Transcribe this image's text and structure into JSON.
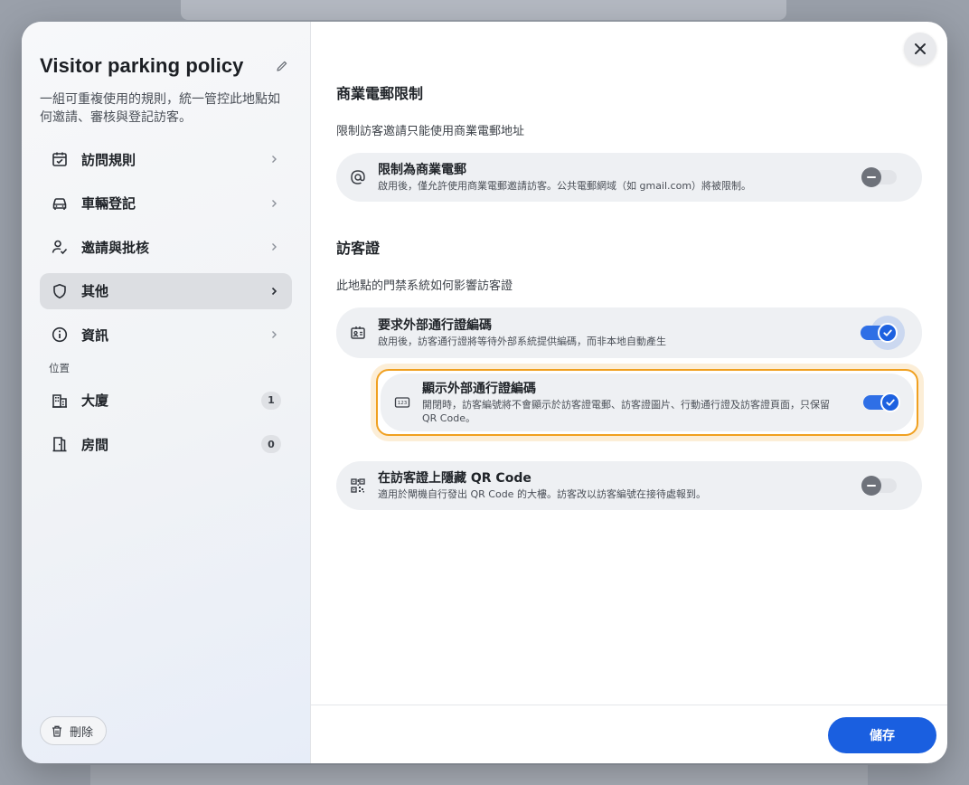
{
  "sidebar": {
    "title": "Visitor parking policy",
    "description": "一組可重複使用的規則，統一管控此地點如何邀請、審核與登記訪客。",
    "nav": [
      {
        "label": "訪問規則",
        "icon": "calendar-check-icon"
      },
      {
        "label": "車輛登記",
        "icon": "car-icon"
      },
      {
        "label": "邀請與批核",
        "icon": "user-check-icon"
      },
      {
        "label": "其他",
        "icon": "shield-icon",
        "active": true
      },
      {
        "label": "資訊",
        "icon": "info-icon"
      }
    ],
    "location_label": "位置",
    "locations": [
      {
        "label": "大廈",
        "icon": "building-icon",
        "count": "1"
      },
      {
        "label": "房間",
        "icon": "door-icon",
        "count": "0"
      }
    ],
    "delete_label": "刪除"
  },
  "main": {
    "section1": {
      "title": "商業電郵限制",
      "subtitle": "限制訪客邀請只能使用商業電郵地址",
      "card": {
        "title": "限制為商業電郵",
        "desc": "啟用後，僅允許使用商業電郵邀請訪客。公共電郵網域（如 gmail.com）將被限制。",
        "icon": "at-sign-icon",
        "enabled": false
      }
    },
    "section2": {
      "title": "訪客證",
      "subtitle": "此地點的門禁系統如何影響訪客證",
      "card1": {
        "title": "要求外部通行證編碼",
        "desc": "啟用後，訪客通行證將等待外部系統提供編碼，而非本地自動產生",
        "icon": "id-badge-icon",
        "enabled": true
      },
      "card2": {
        "title": "顯示外部通行證編碼",
        "desc": "開閉時，訪客編號將不會顯示於訪客證電郵、訪客證圖片、行動通行證及訪客證頁面，只保留 QR Code。",
        "icon": "number-badge-icon",
        "enabled": true
      },
      "card3": {
        "title": "在訪客證上隱藏 QR Code",
        "desc": "適用於閘機自行發出 QR Code 的大樓。訪客改以訪客編號在接待處報到。",
        "icon": "qr-code-icon",
        "enabled": false
      }
    }
  },
  "footer": {
    "save_label": "儲存"
  },
  "colors": {
    "primary": "#1a5fe0",
    "highlight": "#f0a020"
  }
}
